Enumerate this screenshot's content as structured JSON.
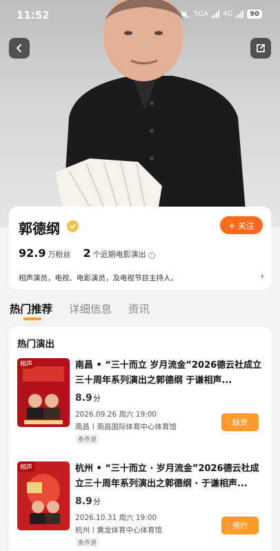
{
  "status_bar": {
    "time": "11:52",
    "network": "5GA",
    "network2": "4G",
    "battery": "90"
  },
  "nav": {
    "back_icon": "chevron-left-icon",
    "share_icon": "share-out-icon"
  },
  "profile": {
    "name": "郭德纲",
    "follow_label": "+ 关注",
    "fans_value": "92.9",
    "fans_unit": "万粉丝",
    "movie_count": "2",
    "movie_label": "个近期电影演出",
    "bio": "相声演员，电视、电影演员，及电视节目主持人。",
    "accent_color": "#ff6a1a"
  },
  "tabs": [
    {
      "label": "热门推荐",
      "active": true
    },
    {
      "label": "详细信息",
      "active": false
    },
    {
      "label": "资讯",
      "active": false
    }
  ],
  "hot_shows": {
    "title": "热门演出",
    "items": [
      {
        "tag": "相声",
        "title": "南昌 • “三十而立 岁月流金”2026德云社成立三十周年系列演出之郭德纲 于谦相声...",
        "score": "8.9",
        "score_unit": "分",
        "datetime": "2026.09.26 周六 19:00",
        "venue": "南昌丨南昌国际体育中心体育馆",
        "condition": "条件退",
        "action": "缺货"
      },
      {
        "tag": "相声",
        "title": "杭州 • “三十而立 · 岁月流金”2026德云社成立三十周年系列演出之郭德纲 · 于谦相声...",
        "score": "8.9",
        "score_unit": "分",
        "datetime": "2026.10.31 周六 19:00",
        "venue": "杭州丨黄龙体育中心体育馆",
        "condition": "条件退",
        "action": "预约"
      }
    ]
  }
}
